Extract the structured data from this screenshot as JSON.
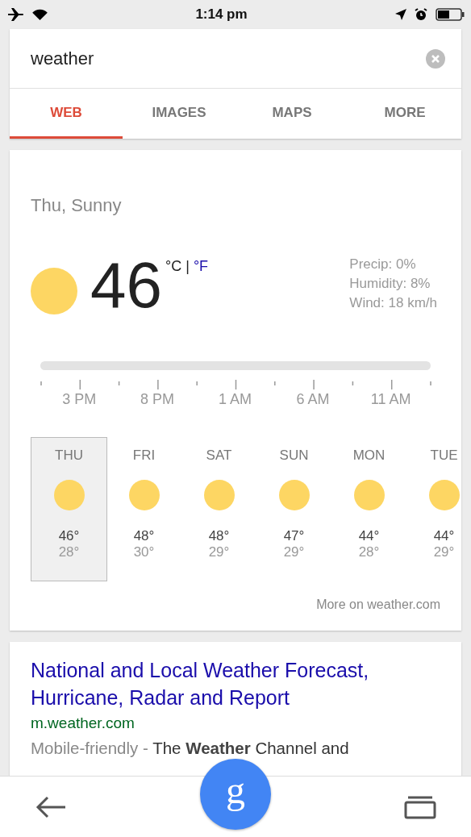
{
  "status_bar": {
    "time": "1:14 pm"
  },
  "search": {
    "value": "weather"
  },
  "tabs": [
    {
      "label": "WEB",
      "selected": true
    },
    {
      "label": "IMAGES",
      "selected": false
    },
    {
      "label": "MAPS",
      "selected": false
    },
    {
      "label": "MORE",
      "selected": false
    }
  ],
  "weather": {
    "condition": "Thu, Sunny",
    "temperature": "46",
    "units": [
      {
        "label": "°C",
        "selected": true
      },
      {
        "label": "°F",
        "selected": false
      }
    ],
    "unit_separator": "|",
    "details": [
      "Precip: 0%",
      "Humidity: 8%",
      "Wind: 18 km/h"
    ],
    "hours": [
      "3 PM",
      "8 PM",
      "1 AM",
      "6 AM",
      "11 AM"
    ],
    "days": [
      {
        "day": "THU",
        "high": "46°",
        "low": "28°",
        "selected": true
      },
      {
        "day": "FRI",
        "high": "48°",
        "low": "30°",
        "selected": false
      },
      {
        "day": "SAT",
        "high": "48°",
        "low": "29°",
        "selected": false
      },
      {
        "day": "SUN",
        "high": "47°",
        "low": "29°",
        "selected": false
      },
      {
        "day": "MON",
        "high": "44°",
        "low": "28°",
        "selected": false
      },
      {
        "day": "TUE",
        "high": "44°",
        "low": "29°",
        "selected": false
      }
    ],
    "more_link": "More on weather.com"
  },
  "result": {
    "title": "National and Local Weather Forecast, Hurricane, Radar and Report",
    "url": "m.weather.com",
    "badge": "Mobile-friendly -",
    "snippet": "The **Weather** Channel and"
  },
  "bottom_bar": {
    "assistant_letter": "g"
  }
}
